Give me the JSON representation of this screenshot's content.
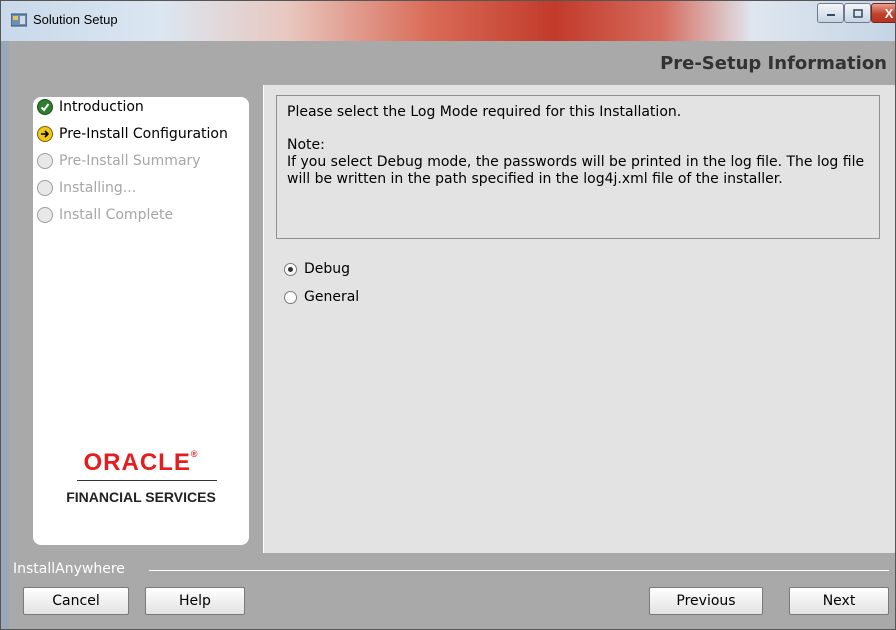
{
  "window": {
    "title": "Solution Setup",
    "close_glyph": "X"
  },
  "header": {
    "title": "Pre-Setup Information"
  },
  "steps": [
    {
      "label": "Introduction",
      "state": "done"
    },
    {
      "label": "Pre-Install Configuration",
      "state": "current"
    },
    {
      "label": "Pre-Install Summary",
      "state": "pending"
    },
    {
      "label": "Installing...",
      "state": "pending"
    },
    {
      "label": "Install Complete",
      "state": "pending"
    }
  ],
  "branding": {
    "logo_text": "ORACLE",
    "subtitle": "FINANCIAL SERVICES"
  },
  "content": {
    "instruction": "Please select the Log Mode required for this Installation.",
    "note_label": "Note:",
    "note_text": "If you select Debug mode, the passwords will be printed in the log file. The log file will be written in the path specified in the log4j.xml file of the installer."
  },
  "log_mode": {
    "options": [
      "Debug",
      "General"
    ],
    "selected": "Debug"
  },
  "footer": {
    "brand": "InstallAnywhere",
    "cancel_label": "Cancel",
    "help_label": "Help",
    "previous_label": "Previous",
    "next_label": "Next"
  },
  "colors": {
    "logo_red": "#e41e1e",
    "header_gray": "#a9a9a9",
    "done_green": "#2e7d2e",
    "current_yellow": "#f0c818"
  }
}
